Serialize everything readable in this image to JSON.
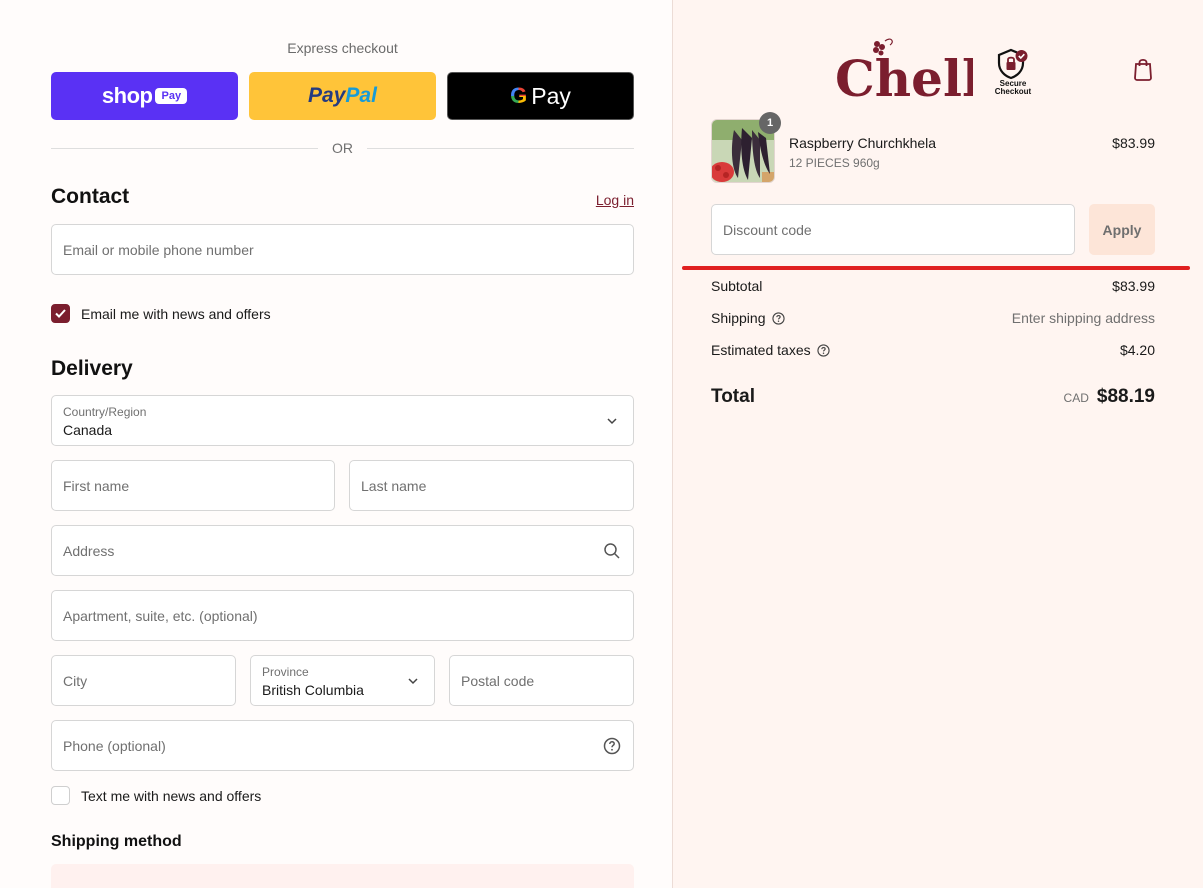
{
  "express": {
    "title": "Express checkout",
    "shop_pay": {
      "word": "shop",
      "pill": "Pay"
    },
    "paypal": {
      "part1": "Pay",
      "part2": "Pal"
    },
    "gpay": {
      "g": "G",
      "word": "Pay"
    },
    "or": "OR"
  },
  "contact": {
    "heading": "Contact",
    "login": "Log in",
    "email_placeholder": "Email or mobile phone number",
    "news_label": "Email me with news and offers",
    "news_checked": true
  },
  "delivery": {
    "heading": "Delivery",
    "country_label": "Country/Region",
    "country_value": "Canada",
    "first_name": "First name",
    "last_name": "Last name",
    "address": "Address",
    "apartment": "Apartment, suite, etc. (optional)",
    "city": "City",
    "province_label": "Province",
    "province_value": "British Columbia",
    "postal": "Postal code",
    "phone": "Phone (optional)",
    "sms_label": "Text me with news and offers"
  },
  "shipping": {
    "heading": "Shipping method"
  },
  "brand": {
    "logo_text": "Chella",
    "secure_line1": "Secure",
    "secure_line2": "Checkout"
  },
  "cart": {
    "item": {
      "name": "Raspberry Churchkhela",
      "variant": "12 PIECES 960g",
      "price": "$83.99",
      "quantity": "1"
    },
    "discount_placeholder": "Discount code",
    "apply": "Apply",
    "subtotal_label": "Subtotal",
    "subtotal": "$83.99",
    "shipping_label": "Shipping",
    "shipping_value": "Enter shipping address",
    "taxes_label": "Estimated taxes",
    "taxes": "$4.20",
    "total_label": "Total",
    "currency": "CAD",
    "total": "$88.19"
  },
  "colors": {
    "accent": "#7b1e2e",
    "shop_pay": "#5a31f4",
    "paypal": "#ffc439",
    "annotation_line": "#e02020"
  }
}
